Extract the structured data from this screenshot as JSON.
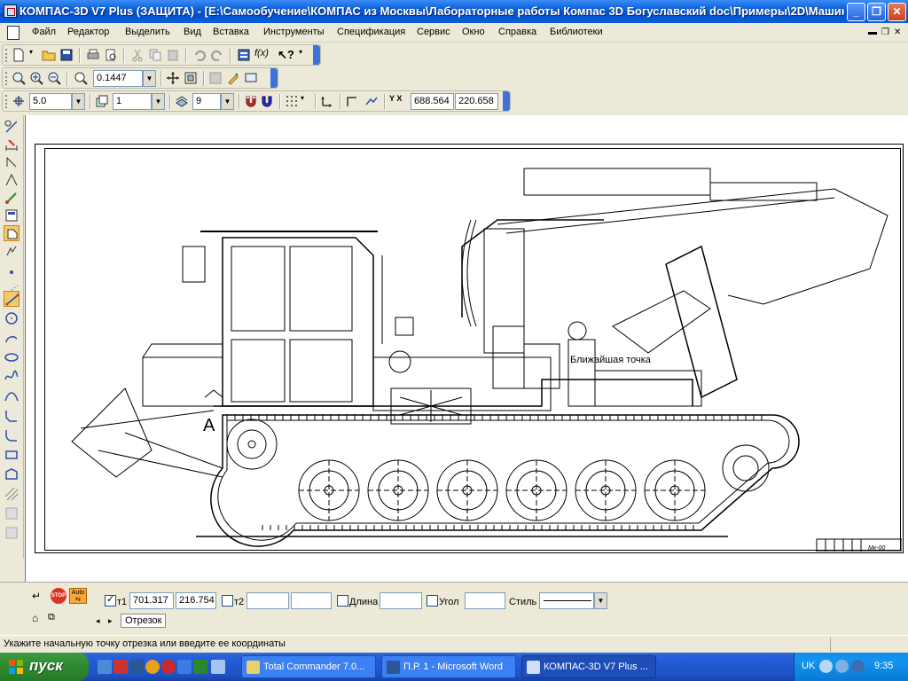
{
  "window": {
    "title": "КОМПАС-3D V7 Plus (ЗАЩИТА) - [E:\\Самообучение\\КОМПАС из Москвы\\Лабораторные работы Компас 3D Богуславский doc\\Примеры\\2D\\Машин..."
  },
  "menu": {
    "items": [
      "Файл",
      "Редактор",
      "Выделить",
      "Вид",
      "Вставка",
      "Инструменты",
      "Спецификация",
      "Сервис",
      "Окно",
      "Справка",
      "Библиотеки"
    ]
  },
  "toolbar_view": {
    "zoom_value": "0.1447"
  },
  "toolbar_current": {
    "step_value": "5.0",
    "layer_value": "1",
    "style_value": "9",
    "coord_x": "688.564",
    "coord_y": "220.658"
  },
  "drawing": {
    "view_label": "А",
    "tooltip_text": "Ближайшая точка"
  },
  "property_panel": {
    "t1_label": "т1",
    "t1_x": "701.317",
    "t1_y": "216.754",
    "t2_label": "т2",
    "t2_x": "",
    "t2_y": "",
    "length_label": "Длина",
    "length_value": "",
    "angle_label": "Угол",
    "angle_value": "",
    "style_label": "Стиль",
    "tab_label": "Отрезок",
    "stop_label": "STOP",
    "auto_label": "Auto"
  },
  "status": {
    "text": "Укажите начальную точку отрезка или введите ее координаты"
  },
  "taskbar": {
    "start_label": "пуск",
    "tasks": [
      {
        "label": "Total Commander 7.0...",
        "active": false
      },
      {
        "label": "П.Р. 1 - Microsoft Word",
        "active": false
      },
      {
        "label": "КОМПАС-3D V7 Plus ...",
        "active": true
      }
    ],
    "lang": "UK",
    "clock": "9:35"
  }
}
